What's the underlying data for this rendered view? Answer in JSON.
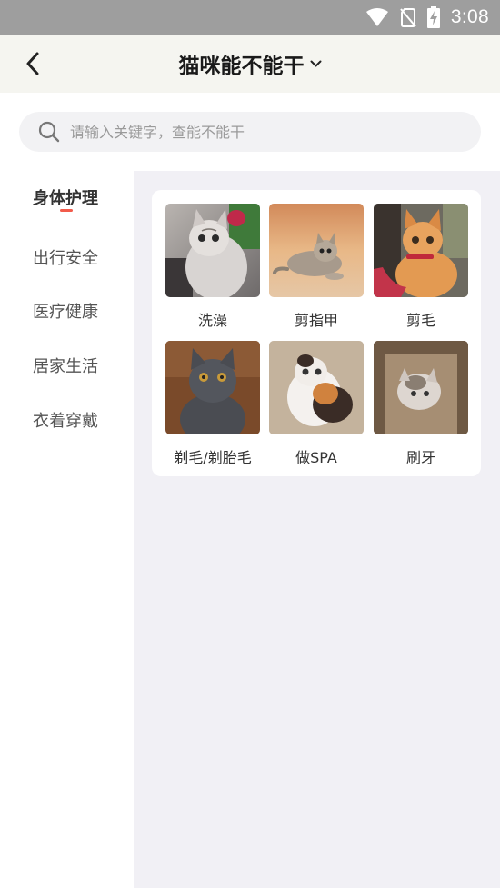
{
  "status_bar": {
    "time": "3:08",
    "icons": [
      "wifi-icon",
      "no-sim-icon",
      "battery-charging-icon"
    ]
  },
  "header": {
    "title": "猫咪能不能干",
    "back_icon": "chevron-left-icon",
    "dropdown_icon": "chevron-down-icon"
  },
  "search": {
    "placeholder": "请输入关键字，查能不能干",
    "value": ""
  },
  "sidebar": {
    "active_index": 0,
    "items": [
      {
        "label": "身体护理"
      },
      {
        "label": "出行安全"
      },
      {
        "label": "医疗健康"
      },
      {
        "label": "居家生活"
      },
      {
        "label": "衣着穿戴"
      }
    ]
  },
  "grid": {
    "items": [
      {
        "label": "洗澡"
      },
      {
        "label": "剪指甲"
      },
      {
        "label": "剪毛"
      },
      {
        "label": "剃毛/剃胎毛"
      },
      {
        "label": "做SPA"
      },
      {
        "label": "刷牙"
      }
    ]
  },
  "colors": {
    "accent": "#f25b4b",
    "status_bar": "#9e9e9e",
    "header_bg": "#f5f5f0",
    "content_bg": "#f1f0f5"
  }
}
